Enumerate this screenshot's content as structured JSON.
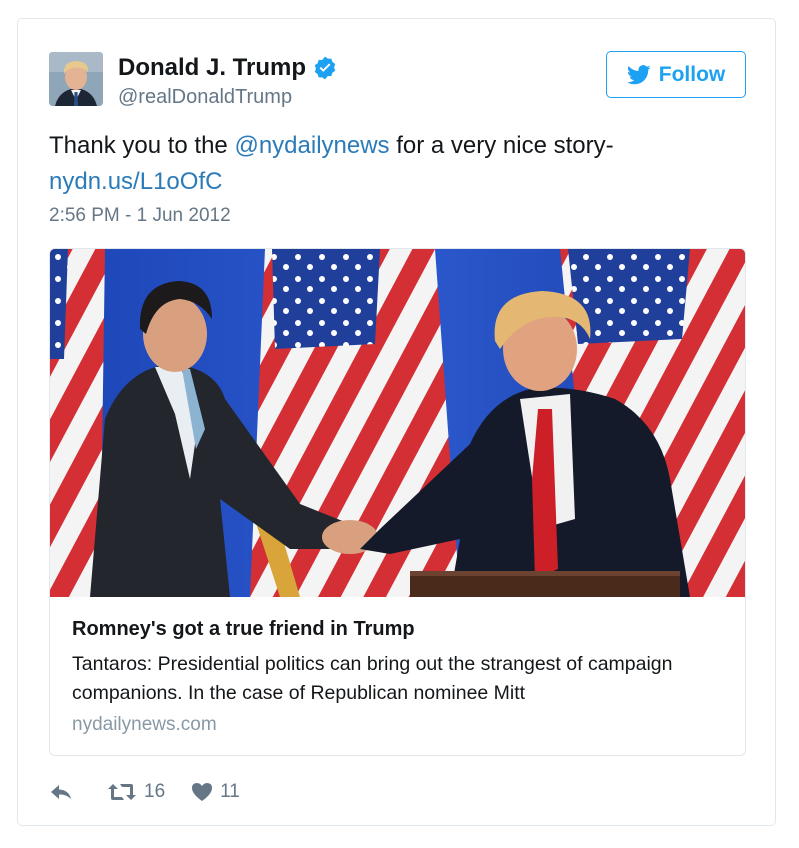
{
  "tweet": {
    "author": {
      "display_name": "Donald J. Trump",
      "handle": "@realDonaldTrump",
      "verified": true
    },
    "follow_label": "Follow",
    "text_before": "Thank you to the ",
    "mention": "@nydailynews",
    "text_after": " for a very nice story-",
    "link": "nydn.us/L1oOfC",
    "timestamp": "2:56 PM - 1 Jun 2012"
  },
  "card": {
    "title": "Romney's got a true friend in Trump",
    "description": "Tantaros: Presidential politics can bring out the strangest of campaign companions. In the case of Republican nominee Mitt",
    "domain": "nydailynews.com"
  },
  "actions": {
    "retweets": "16",
    "likes": "11"
  },
  "colors": {
    "link": "#2b7bb9",
    "accent": "#1da1f2",
    "muted": "#657786",
    "border": "#e1e8ed"
  },
  "icons": {
    "verified": "verified-badge-icon",
    "follow": "twitter-bird-icon",
    "reply": "reply-icon",
    "retweet": "retweet-icon",
    "like": "heart-icon"
  }
}
